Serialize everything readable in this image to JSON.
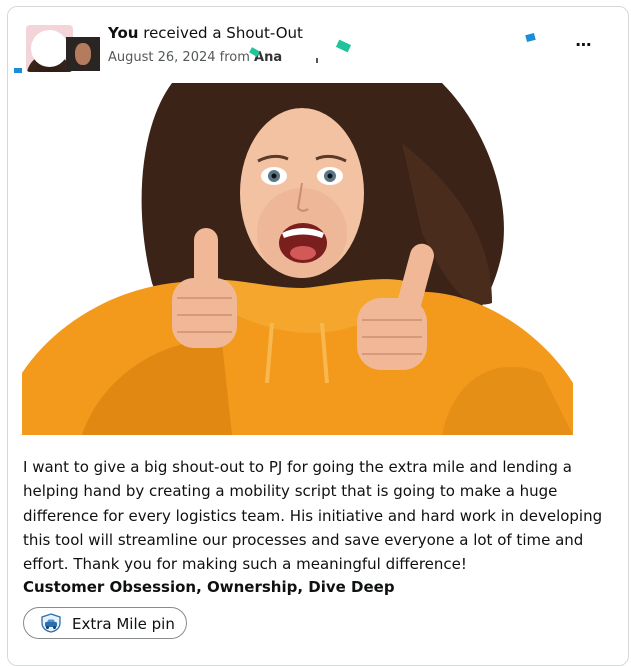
{
  "post": {
    "title_bold": "You",
    "title_rest": " received a Shout-Out",
    "date_prefix": "August 26, 2024 from ",
    "sender": "Ana",
    "more_label": "⋯"
  },
  "message": {
    "text": "I want to give a big shout-out to PJ for going the extra mile and lending a helping hand by creating a mobility script that is going to make a huge difference for every logistics team. His initiative and hard work in developing this tool will streamline our processes and save everyone a lot of time and effort. Thank you for making such a meaningful difference!",
    "values": "Customer Obsession, Ownership, Dive Deep"
  },
  "pin": {
    "label": "Extra Mile pin",
    "icon": "car-badge-icon"
  },
  "colors": {
    "confetti_teal": "#1fc49a",
    "confetti_blue": "#1a8fd8",
    "sweater_orange": "#f39a1c"
  }
}
